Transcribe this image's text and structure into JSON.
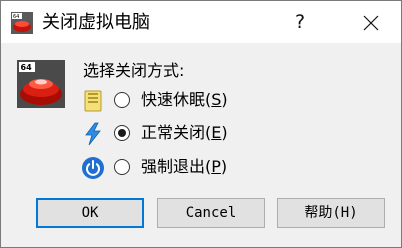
{
  "window": {
    "title": "关闭虚拟电脑",
    "help_glyph": "?",
    "close_glyph": "✕"
  },
  "dialog": {
    "prompt": "选择关闭方式:",
    "options": [
      {
        "text": "快速休眠",
        "mnemonic_open": "(",
        "mnemonic": "S",
        "mnemonic_close": ")",
        "selected": false,
        "icon": "save-state-icon"
      },
      {
        "text": "正常关闭",
        "mnemonic_open": "(",
        "mnemonic": "E",
        "mnemonic_close": ")",
        "selected": true,
        "icon": "acpi-lightning-icon"
      },
      {
        "text": "强制退出",
        "mnemonic_open": "(",
        "mnemonic": "P",
        "mnemonic_close": ")",
        "selected": false,
        "icon": "power-off-icon"
      }
    ],
    "buttons": {
      "ok": "OK",
      "cancel": "Cancel",
      "help": "帮助(H)"
    }
  },
  "colors": {
    "accent": "#0078d7",
    "dialog_bg": "#f0f0f0",
    "button_bg": "#e1e1e1"
  }
}
